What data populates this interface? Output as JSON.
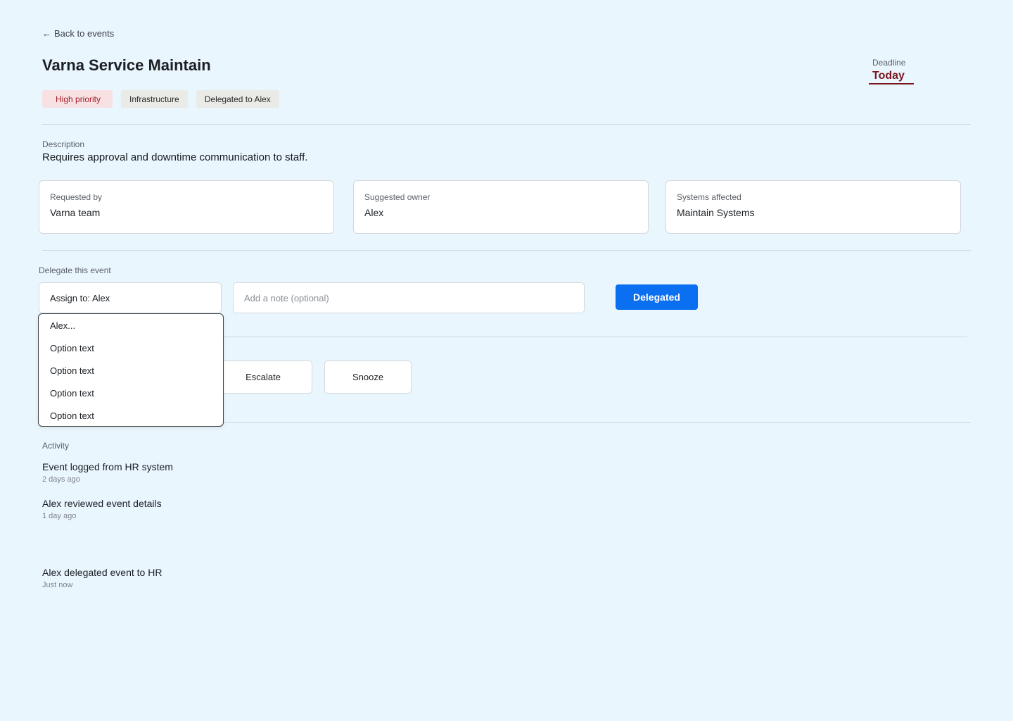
{
  "nav": {
    "back_arrow": "←",
    "back_label": "Back to events"
  },
  "event": {
    "title": "Varna Service Maintain",
    "tags": [
      "High priority",
      "Infrastructure",
      "Delegated to Alex"
    ],
    "deadline_label": "Deadline",
    "deadline_value": "Today",
    "description_label": "Description",
    "description": "Requires approval and downtime communication to staff."
  },
  "cards": [
    {
      "label": "Requested by",
      "value": "Varna team"
    },
    {
      "label": "Suggested owner",
      "value": "Alex"
    },
    {
      "label": "Systems affected",
      "value": "Maintain Systems"
    }
  ],
  "delegate": {
    "section_label": "Delegate this event",
    "assign_value": "Assign to: Alex",
    "note_placeholder": "Add a note (optional)",
    "note_value": "",
    "submit_label": "Delegated",
    "dropdown_options": [
      "Alex...",
      "Option text",
      "Option text",
      "Option text",
      "Option text"
    ]
  },
  "actions": {
    "escalate_label": "Escalate",
    "snooze_label": "Snooze"
  },
  "activity": {
    "section_label": "Activity",
    "items": [
      {
        "title": "Event logged from HR system",
        "time": "2 days ago"
      },
      {
        "title": "Alex reviewed event details",
        "time": "1 day ago"
      },
      {
        "title": "Alex delegated event to HR",
        "time": "Just now"
      }
    ]
  },
  "colors": {
    "background": "#eaf6fd",
    "primary_button": "#0a6ff0",
    "priority_tag_bg": "#f7e1e3",
    "priority_tag_text": "#a3202a",
    "deadline": "#7a1620"
  }
}
